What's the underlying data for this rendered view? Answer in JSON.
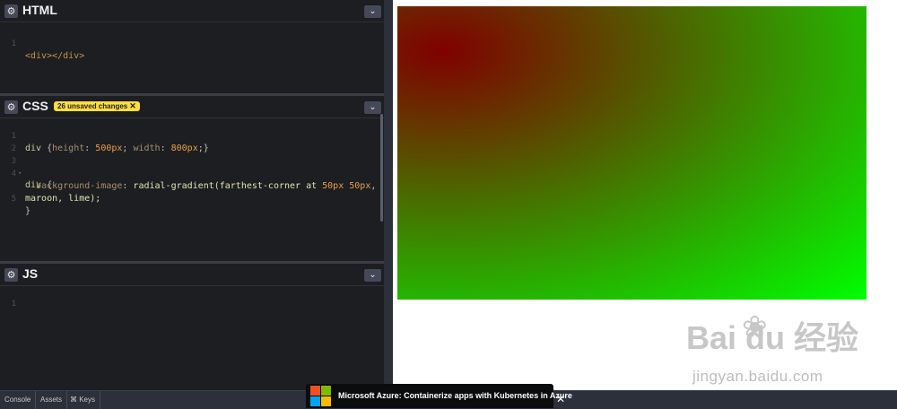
{
  "panels": {
    "html": {
      "title": "HTML",
      "lines": [
        {
          "n": "1",
          "code": "<div></div>"
        }
      ]
    },
    "css": {
      "title": "CSS",
      "badge": "26 unsaved changes",
      "lines": [
        {
          "n": "1",
          "code": "div {height: 500px; width: 800px;}"
        },
        {
          "n": "2",
          "code": ""
        },
        {
          "n": "3",
          "code": "div {"
        },
        {
          "n": "4",
          "code": "  background-image: radial-gradient(farthest-corner at 50px 50px,"
        },
        {
          "n": "",
          "code": "maroon, lime);"
        },
        {
          "n": "5",
          "code": "}"
        }
      ]
    },
    "js": {
      "title": "JS",
      "lines": [
        {
          "n": "1",
          "code": ""
        }
      ]
    }
  },
  "bottom_bar": {
    "console": "Console",
    "assets": "Assets",
    "keys": "⌘ Keys"
  },
  "ad": {
    "text": "Microsoft Azure: Containerize apps with Kubernetes in Azure",
    "close": "✕",
    "logo_colors": [
      "#f25022",
      "#7fba00",
      "#00a4ef",
      "#ffb900"
    ]
  },
  "icons": {
    "settings": "⚙",
    "collapse": "⌄",
    "close_badge": "✕"
  },
  "watermark": {
    "logo": "Bai  du 经验",
    "paw": "❀",
    "url": "jingyan.baidu.com"
  },
  "colors": {
    "editor_bg": "#1d1e22",
    "badge": "#ffdd40",
    "gradient_start": "maroon",
    "gradient_end": "lime"
  }
}
